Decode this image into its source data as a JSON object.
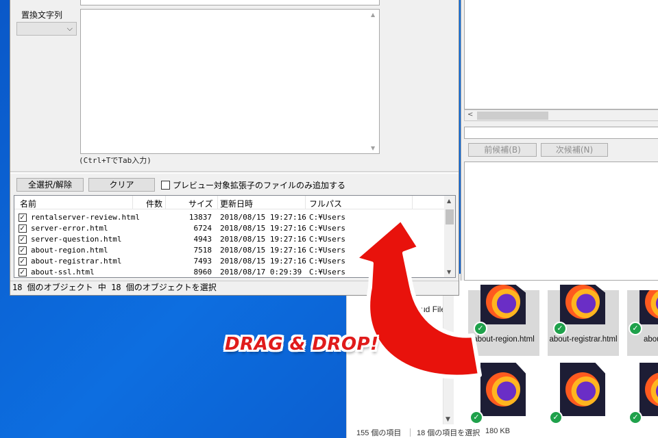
{
  "explorer": {
    "nav_item": "Cloud File",
    "files": [
      {
        "name": "about-region.html",
        "status": "synced"
      },
      {
        "name": "about-registrar.html",
        "status": "synced"
      },
      {
        "name": "about",
        "status": "synced"
      },
      {
        "name": "",
        "status": "synced"
      },
      {
        "name": "",
        "status": "synced"
      },
      {
        "name": "",
        "status": "synced"
      }
    ],
    "status": {
      "items": "155 個の項目",
      "selected": "18 個の項目を選択",
      "size": "180 KB"
    }
  },
  "preview_panel": {
    "prev_label": "前候補(B)",
    "next_label": "次候補(N)"
  },
  "dialog": {
    "replace_label": "置換文字列",
    "hint": "(Ctrl+TでTab入力)",
    "select_all_label": "全選択/解除",
    "clear_label": "クリア",
    "preview_only_label": "プレビュー対象拡張子のファイルのみ追加する",
    "preview_only_checked": false,
    "columns": {
      "name": "名前",
      "count": "件数",
      "size": "サイズ",
      "updated": "更新日時",
      "fullpath": "フルパス"
    },
    "rows": [
      {
        "checked": true,
        "name": "rentalserver-review.html",
        "count": "",
        "size": "13837",
        "updated": "2018/08/15  19:27:16",
        "path": "C:¥Users"
      },
      {
        "checked": true,
        "name": "server-error.html",
        "count": "",
        "size": "6724",
        "updated": "2018/08/15  19:27:16",
        "path": "C:¥Users"
      },
      {
        "checked": true,
        "name": "server-question.html",
        "count": "",
        "size": "4943",
        "updated": "2018/08/15  19:27:16",
        "path": "C:¥Users"
      },
      {
        "checked": true,
        "name": "about-region.html",
        "count": "",
        "size": "7518",
        "updated": "2018/08/15  19:27:16",
        "path": "C:¥Users"
      },
      {
        "checked": true,
        "name": "about-registrar.html",
        "count": "",
        "size": "7493",
        "updated": "2018/08/15  19:27:16",
        "path": "C:¥Users"
      },
      {
        "checked": true,
        "name": "about-ssl.html",
        "count": "",
        "size": "8960",
        "updated": "2018/08/17   0:29:39",
        "path": "C:¥Users"
      }
    ],
    "status": "18 個のオブジェクト 中 18 個のオブジェクトを選択"
  },
  "overlay": {
    "caption": "DRAG & DROP!",
    "arrow_color": "#e8120c"
  },
  "colors": {
    "desktop": "#0d6ee0",
    "dialog_bg": "#f0f0f0",
    "check_green": "#1fa14b"
  }
}
